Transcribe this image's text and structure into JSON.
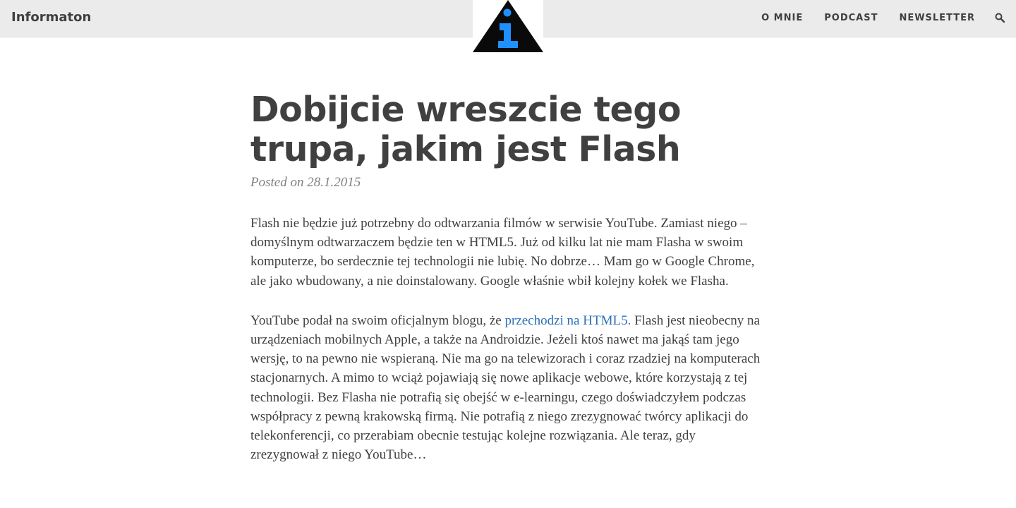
{
  "header": {
    "brand": "Informaton",
    "nav": [
      "O MNIE",
      "PODCAST",
      "NEWSLETTER"
    ],
    "search_icon": "search-icon",
    "logo_icon": "info-triangle-logo"
  },
  "colors": {
    "topbar_bg": "#ebebeb",
    "text": "#404040",
    "meta": "#808080",
    "link": "#2b6fb6",
    "logo_blue": "#1e90ff"
  },
  "post": {
    "title": "Dobijcie wreszcie tego trupa, jakim jest Flash",
    "meta_prefix": "Posted on",
    "date": "28.1.2015",
    "paragraph1": "Flash nie będzie już potrzebny do odtwarzania filmów w serwisie YouTube. Zamiast niego – domyślnym odtwarzaczem będzie ten w HTML5. Już od kilku lat nie mam Flasha w swoim komputerze, bo serdecznie tej technologii nie lubię. No dobrze… Mam go w Google Chrome, ale jako wbudowany, a nie doinstalowany. Google właśnie wbił kolejny kołek we Flasha.",
    "paragraph2_before": "YouTube podał na swoim oficjalnym blogu, że ",
    "paragraph2_link": "przechodzi na HTML5.",
    "paragraph2_after": " Flash jest nieobecny na urządzeniach mobilnych Apple, a także na Androidzie. Jeżeli ktoś nawet ma jakąś tam jego wersję, to na pewno nie wspieraną. Nie ma go na telewizorach i coraz rzadziej na komputerach stacjonarnych. A mimo to wciąż pojawiają się nowe aplikacje webowe, które korzystają z tej technologii. Bez Flasha nie potrafią się obejść w e-learningu, czego doświadczyłem podczas współpracy z pewną krakowską firmą. Nie potrafią z niego zrezygnować twórcy aplikacji do telekonferencji, co przerabiam obecnie testując kolejne rozwiązania. Ale teraz, gdy zrezygnował z niego YouTube…"
  }
}
